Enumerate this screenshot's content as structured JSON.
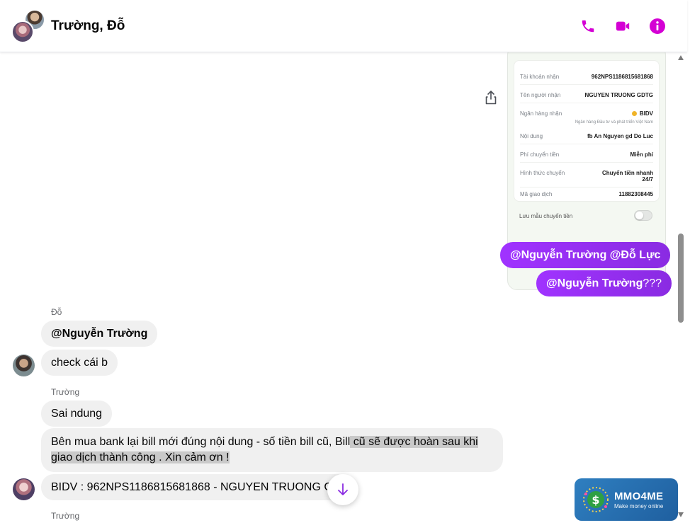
{
  "header": {
    "title": "Trường, Đỗ"
  },
  "receipt": {
    "rows": [
      {
        "label": "Tài khoản nhận",
        "value": "962NPS1186815681868"
      },
      {
        "label": "Tên người nhận",
        "value": "NGUYEN TRUONG GDTG"
      },
      {
        "label": "Ngân hàng nhận",
        "value": "BIDV",
        "sub": "Ngân hàng Đầu tư và phát triển Việt Nam"
      },
      {
        "label": "Nội dung",
        "value": "fb An Nguyen gd Do Luc"
      },
      {
        "label": "Phí chuyển tiền",
        "value": "Miễn phí"
      },
      {
        "label": "Hình thức chuyển",
        "value": "Chuyển tiền nhanh 24/7"
      },
      {
        "label": "Mã giao dịch",
        "value": "11882308445"
      }
    ],
    "save_label": "Lưu mẫu chuyển tiền"
  },
  "messages": {
    "out1": "@Nguyễn Trường @Đỗ Lực",
    "out2_mention": "@Nguyễn Trường",
    "out2_rest": "???",
    "do_sender": "Đỗ",
    "do_msg1": "@Nguyễn Trường",
    "do_msg2": "check cái b",
    "truong_sender": "Trường",
    "truong_msg1": "Sai ndung",
    "truong_msg2_part1": "Bên mua bank lại bill mới đúng nội dung - số tiền bill cũ, Bill",
    "truong_msg2_part2": " cũ sẽ được hoàn sau khi giao dịch thành công . Xin cảm ơn !",
    "truong_msg3": "BIDV : 962NPS1186815681868 - NGUYEN TRUONG G",
    "truong_sender_2": "Trường"
  },
  "watermark": {
    "title": "MMO4ME",
    "subtitle": "Make money online"
  },
  "colors": {
    "accent": "#d400d4",
    "outgoing_bubble": "#9b30ff",
    "incoming_bubble": "#f0f0f0"
  },
  "icons": [
    "phone-icon",
    "video-icon",
    "info-icon",
    "share-icon",
    "arrow-down-icon"
  ]
}
